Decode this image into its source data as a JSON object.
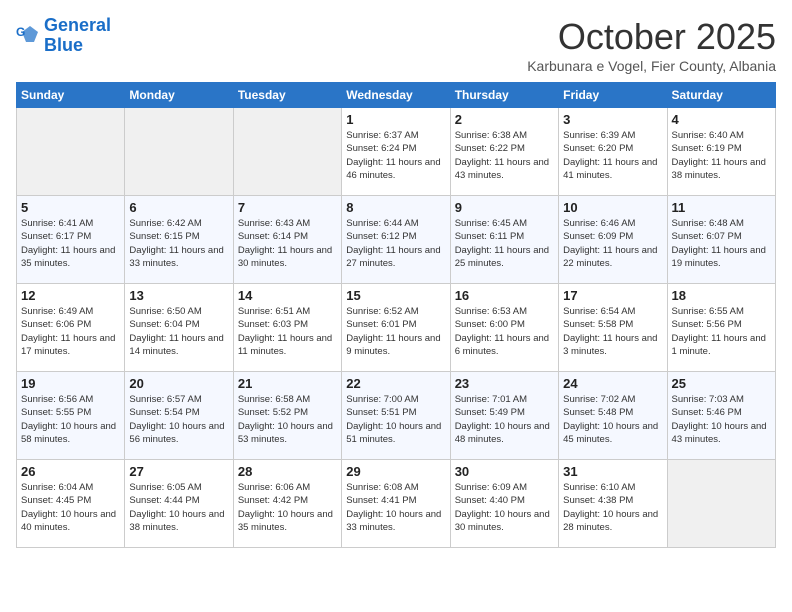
{
  "logo": {
    "line1": "General",
    "line2": "Blue"
  },
  "title": "October 2025",
  "subtitle": "Karbunara e Vogel, Fier County, Albania",
  "weekdays": [
    "Sunday",
    "Monday",
    "Tuesday",
    "Wednesday",
    "Thursday",
    "Friday",
    "Saturday"
  ],
  "weeks": [
    [
      {
        "day": "",
        "sunrise": "",
        "sunset": "",
        "daylight": ""
      },
      {
        "day": "",
        "sunrise": "",
        "sunset": "",
        "daylight": ""
      },
      {
        "day": "",
        "sunrise": "",
        "sunset": "",
        "daylight": ""
      },
      {
        "day": "1",
        "sunrise": "Sunrise: 6:37 AM",
        "sunset": "Sunset: 6:24 PM",
        "daylight": "Daylight: 11 hours and 46 minutes."
      },
      {
        "day": "2",
        "sunrise": "Sunrise: 6:38 AM",
        "sunset": "Sunset: 6:22 PM",
        "daylight": "Daylight: 11 hours and 43 minutes."
      },
      {
        "day": "3",
        "sunrise": "Sunrise: 6:39 AM",
        "sunset": "Sunset: 6:20 PM",
        "daylight": "Daylight: 11 hours and 41 minutes."
      },
      {
        "day": "4",
        "sunrise": "Sunrise: 6:40 AM",
        "sunset": "Sunset: 6:19 PM",
        "daylight": "Daylight: 11 hours and 38 minutes."
      }
    ],
    [
      {
        "day": "5",
        "sunrise": "Sunrise: 6:41 AM",
        "sunset": "Sunset: 6:17 PM",
        "daylight": "Daylight: 11 hours and 35 minutes."
      },
      {
        "day": "6",
        "sunrise": "Sunrise: 6:42 AM",
        "sunset": "Sunset: 6:15 PM",
        "daylight": "Daylight: 11 hours and 33 minutes."
      },
      {
        "day": "7",
        "sunrise": "Sunrise: 6:43 AM",
        "sunset": "Sunset: 6:14 PM",
        "daylight": "Daylight: 11 hours and 30 minutes."
      },
      {
        "day": "8",
        "sunrise": "Sunrise: 6:44 AM",
        "sunset": "Sunset: 6:12 PM",
        "daylight": "Daylight: 11 hours and 27 minutes."
      },
      {
        "day": "9",
        "sunrise": "Sunrise: 6:45 AM",
        "sunset": "Sunset: 6:11 PM",
        "daylight": "Daylight: 11 hours and 25 minutes."
      },
      {
        "day": "10",
        "sunrise": "Sunrise: 6:46 AM",
        "sunset": "Sunset: 6:09 PM",
        "daylight": "Daylight: 11 hours and 22 minutes."
      },
      {
        "day": "11",
        "sunrise": "Sunrise: 6:48 AM",
        "sunset": "Sunset: 6:07 PM",
        "daylight": "Daylight: 11 hours and 19 minutes."
      }
    ],
    [
      {
        "day": "12",
        "sunrise": "Sunrise: 6:49 AM",
        "sunset": "Sunset: 6:06 PM",
        "daylight": "Daylight: 11 hours and 17 minutes."
      },
      {
        "day": "13",
        "sunrise": "Sunrise: 6:50 AM",
        "sunset": "Sunset: 6:04 PM",
        "daylight": "Daylight: 11 hours and 14 minutes."
      },
      {
        "day": "14",
        "sunrise": "Sunrise: 6:51 AM",
        "sunset": "Sunset: 6:03 PM",
        "daylight": "Daylight: 11 hours and 11 minutes."
      },
      {
        "day": "15",
        "sunrise": "Sunrise: 6:52 AM",
        "sunset": "Sunset: 6:01 PM",
        "daylight": "Daylight: 11 hours and 9 minutes."
      },
      {
        "day": "16",
        "sunrise": "Sunrise: 6:53 AM",
        "sunset": "Sunset: 6:00 PM",
        "daylight": "Daylight: 11 hours and 6 minutes."
      },
      {
        "day": "17",
        "sunrise": "Sunrise: 6:54 AM",
        "sunset": "Sunset: 5:58 PM",
        "daylight": "Daylight: 11 hours and 3 minutes."
      },
      {
        "day": "18",
        "sunrise": "Sunrise: 6:55 AM",
        "sunset": "Sunset: 5:56 PM",
        "daylight": "Daylight: 11 hours and 1 minute."
      }
    ],
    [
      {
        "day": "19",
        "sunrise": "Sunrise: 6:56 AM",
        "sunset": "Sunset: 5:55 PM",
        "daylight": "Daylight: 10 hours and 58 minutes."
      },
      {
        "day": "20",
        "sunrise": "Sunrise: 6:57 AM",
        "sunset": "Sunset: 5:54 PM",
        "daylight": "Daylight: 10 hours and 56 minutes."
      },
      {
        "day": "21",
        "sunrise": "Sunrise: 6:58 AM",
        "sunset": "Sunset: 5:52 PM",
        "daylight": "Daylight: 10 hours and 53 minutes."
      },
      {
        "day": "22",
        "sunrise": "Sunrise: 7:00 AM",
        "sunset": "Sunset: 5:51 PM",
        "daylight": "Daylight: 10 hours and 51 minutes."
      },
      {
        "day": "23",
        "sunrise": "Sunrise: 7:01 AM",
        "sunset": "Sunset: 5:49 PM",
        "daylight": "Daylight: 10 hours and 48 minutes."
      },
      {
        "day": "24",
        "sunrise": "Sunrise: 7:02 AM",
        "sunset": "Sunset: 5:48 PM",
        "daylight": "Daylight: 10 hours and 45 minutes."
      },
      {
        "day": "25",
        "sunrise": "Sunrise: 7:03 AM",
        "sunset": "Sunset: 5:46 PM",
        "daylight": "Daylight: 10 hours and 43 minutes."
      }
    ],
    [
      {
        "day": "26",
        "sunrise": "Sunrise: 6:04 AM",
        "sunset": "Sunset: 4:45 PM",
        "daylight": "Daylight: 10 hours and 40 minutes."
      },
      {
        "day": "27",
        "sunrise": "Sunrise: 6:05 AM",
        "sunset": "Sunset: 4:44 PM",
        "daylight": "Daylight: 10 hours and 38 minutes."
      },
      {
        "day": "28",
        "sunrise": "Sunrise: 6:06 AM",
        "sunset": "Sunset: 4:42 PM",
        "daylight": "Daylight: 10 hours and 35 minutes."
      },
      {
        "day": "29",
        "sunrise": "Sunrise: 6:08 AM",
        "sunset": "Sunset: 4:41 PM",
        "daylight": "Daylight: 10 hours and 33 minutes."
      },
      {
        "day": "30",
        "sunrise": "Sunrise: 6:09 AM",
        "sunset": "Sunset: 4:40 PM",
        "daylight": "Daylight: 10 hours and 30 minutes."
      },
      {
        "day": "31",
        "sunrise": "Sunrise: 6:10 AM",
        "sunset": "Sunset: 4:38 PM",
        "daylight": "Daylight: 10 hours and 28 minutes."
      },
      {
        "day": "",
        "sunrise": "",
        "sunset": "",
        "daylight": ""
      }
    ]
  ]
}
